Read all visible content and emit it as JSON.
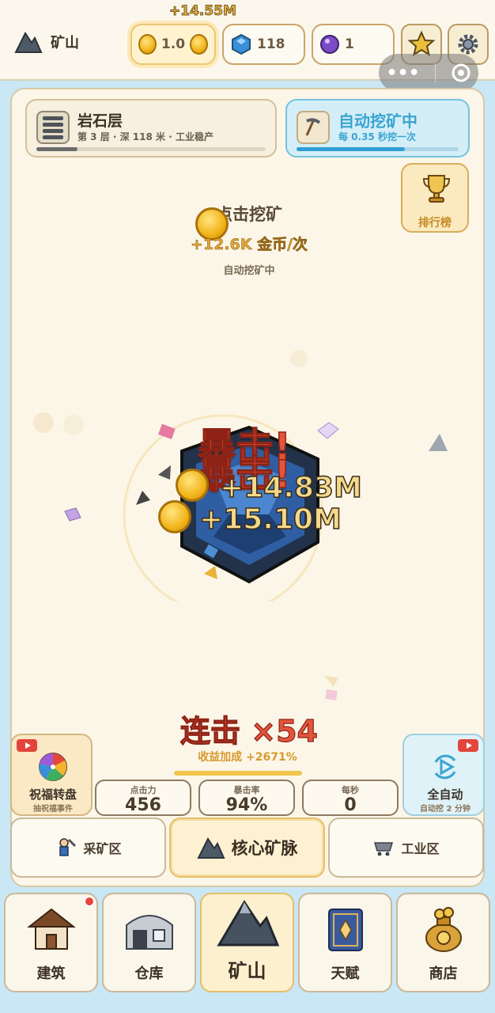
{
  "topbar": {
    "location": "矿山",
    "floating_gain": "+14.55M",
    "coins": "1.0",
    "gems": "118",
    "orbs": "1",
    "capsule_more": "•••"
  },
  "layer": {
    "title": "岩石层",
    "subtitle": "第 3 层 · 深 118 米 · 工业稳产",
    "progress": 0.18
  },
  "auto": {
    "title": "自动挖矿中",
    "subtitle": "每 0.35 秒挖一次",
    "progress": 0.67
  },
  "rank": {
    "label": "排行榜"
  },
  "tap": {
    "title": "点击挖矿",
    "income": "+12.6K 金币/次",
    "status": "自动挖矿中"
  },
  "effects": {
    "crit1": "暴击!",
    "crit2": "暴击!",
    "gain1": "+14.83M",
    "gain2": "+15.10M"
  },
  "combo": {
    "label": "连击 ×54",
    "bonus": "收益加成 +2671%"
  },
  "wheel": {
    "title": "祝福转盘",
    "sub": "抽祝福事件"
  },
  "autoall": {
    "title": "全自动",
    "sub": "自动挖 2 分钟"
  },
  "stats": [
    {
      "label": "点击力",
      "value": "456"
    },
    {
      "label": "暴击率",
      "value": "94%"
    },
    {
      "label": "每秒",
      "value": "0"
    }
  ],
  "zones": [
    {
      "label": "采矿区"
    },
    {
      "label": "核心矿脉"
    },
    {
      "label": "工业区"
    }
  ],
  "nav": [
    {
      "label": "建筑"
    },
    {
      "label": "仓库"
    },
    {
      "label": "矿山"
    },
    {
      "label": "天赋"
    },
    {
      "label": "商店"
    }
  ],
  "colors": {
    "accent": "#e2553d",
    "auto_blue": "#3aa4d2",
    "gold": "#f2b31a"
  }
}
